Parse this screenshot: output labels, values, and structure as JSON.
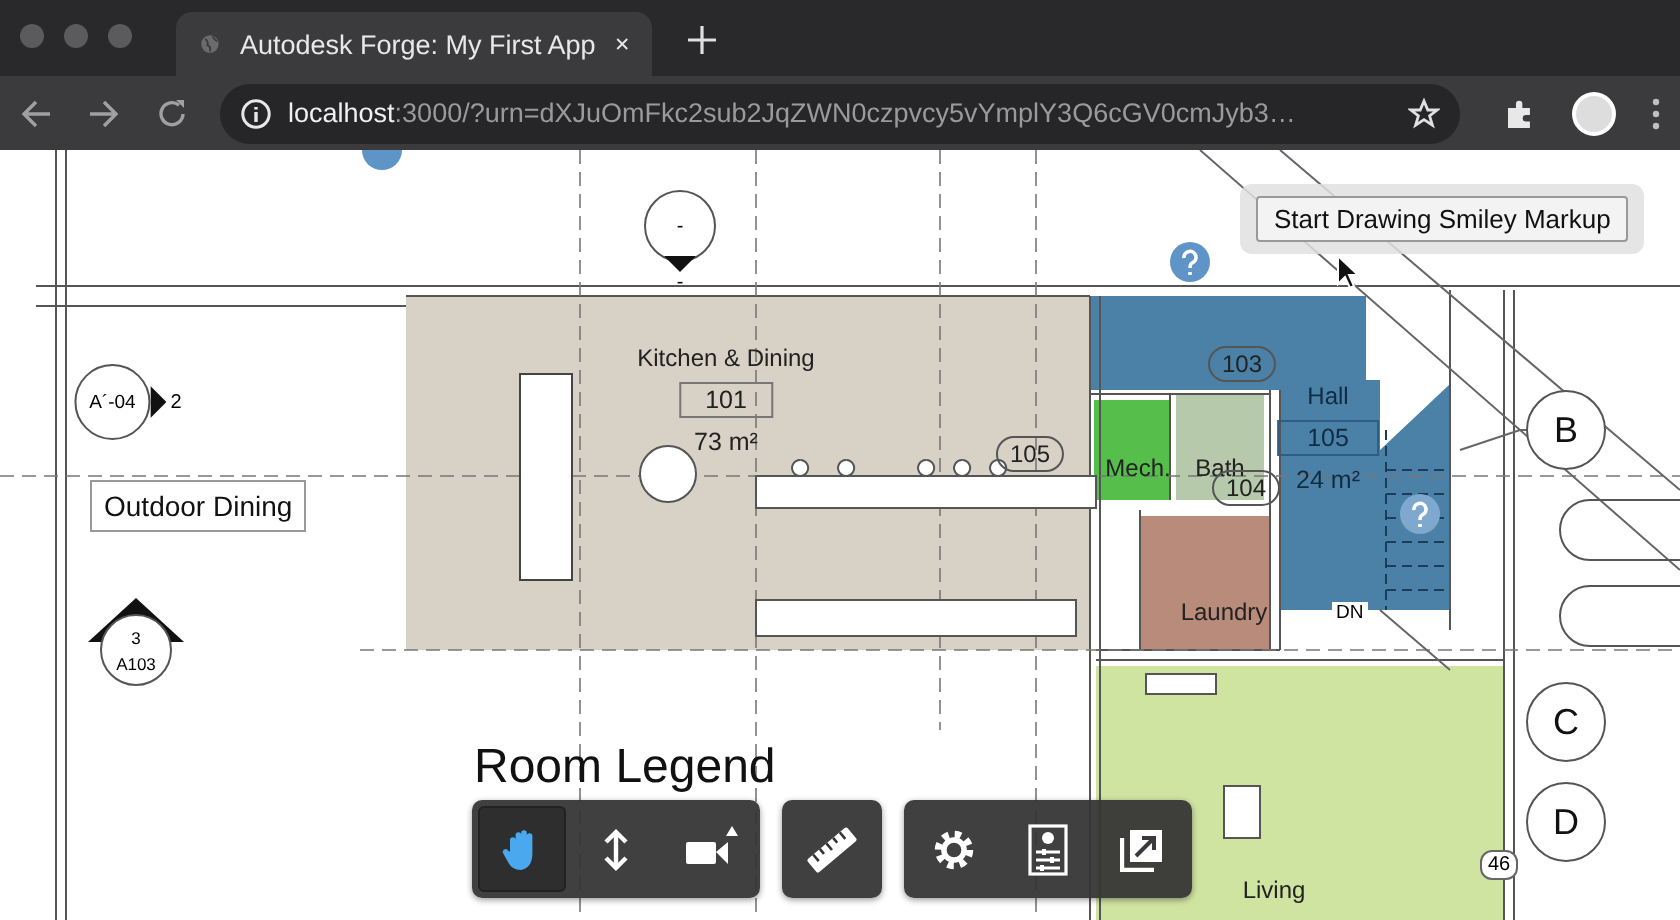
{
  "browser": {
    "tab_title": "Autodesk Forge: My First App",
    "url_host": "localhost",
    "url_rest": ":3000/?urn=dXJuOmFkc2sub2JqZWN0czpvcy5vYmplY3Q6cGV0cmJyb3…"
  },
  "rooms": [
    {
      "name": "Kitchen & Dining",
      "number": "101",
      "area": "73 m²",
      "color": "#d8d1c5"
    },
    {
      "name": "Mech.",
      "color": "#56bf4b"
    },
    {
      "name": "Bath",
      "color": "#b6c9ab"
    },
    {
      "name": "Hall",
      "number": "105",
      "area": "24 m²",
      "color": "#4b81a6"
    },
    {
      "name": "Laundry",
      "color": "#b98b7a"
    },
    {
      "name": "Living",
      "color": "#d0e4a2"
    }
  ],
  "door_tags": [
    "105",
    "103",
    "104"
  ],
  "grid_bubbles": [
    "B",
    "C",
    "D"
  ],
  "view_marks": [
    {
      "kind": "callout",
      "number": "-",
      "sheet": "-"
    },
    {
      "kind": "elevation",
      "number": "2",
      "sheet": "A´-04"
    },
    {
      "kind": "section",
      "number": "3",
      "sheet": "A103"
    }
  ],
  "stair_label": "DN",
  "level_tag": "46",
  "area_label": "Outdoor Dining",
  "legend_title": "Room Legend",
  "markup_button": "Start Drawing Smiley Markup",
  "toolbar": [
    [
      {
        "kind": "pan",
        "selected": true
      },
      {
        "kind": "dolly",
        "selected": false
      },
      {
        "kind": "camera",
        "selected": false
      }
    ],
    [
      {
        "kind": "measure",
        "selected": false
      }
    ],
    [
      {
        "kind": "settings",
        "selected": false
      },
      {
        "kind": "properties",
        "selected": false
      },
      {
        "kind": "fullscreen",
        "selected": false
      }
    ]
  ]
}
